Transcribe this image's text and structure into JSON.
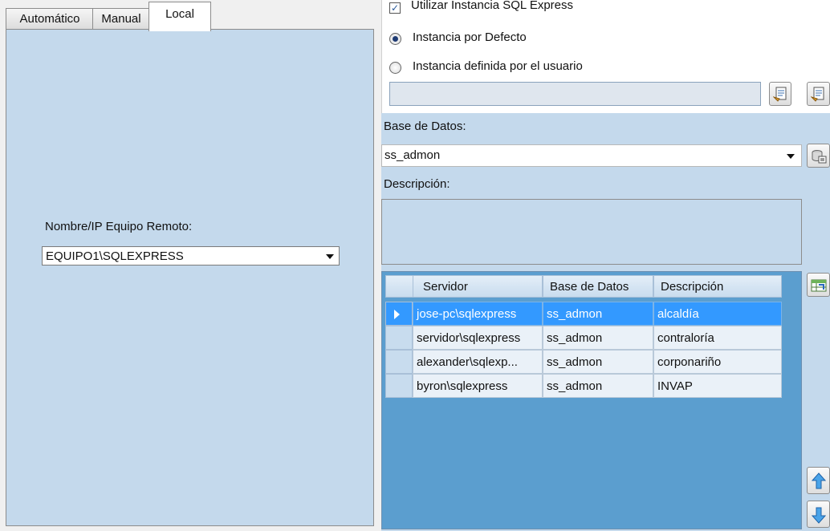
{
  "tabs": [
    {
      "label": "Automático",
      "active": false
    },
    {
      "label": "Manual",
      "active": false
    },
    {
      "label": "Local",
      "active": true
    }
  ],
  "local": {
    "remote_label": "Nombre/IP Equipo Remoto:",
    "remote_value": "EQUIPO1\\SQLEXPRESS"
  },
  "instance": {
    "use_sqlexpress_label": "Utilizar Instancia SQL Express",
    "use_sqlexpress_checked": true,
    "default_label": "Instancia por Defecto",
    "user_defined_label": "Instancia definida por el usuario",
    "selected": "default",
    "custom_value": ""
  },
  "database": {
    "label": "Base de Datos:",
    "value": "ss_admon"
  },
  "description": {
    "label": "Descripción:",
    "value": ""
  },
  "grid": {
    "columns": [
      "Servidor",
      "Base de Datos",
      "Descripción"
    ],
    "rows": [
      {
        "servidor": "jose-pc\\sqlexpress",
        "base": "ss_admon",
        "descripcion": "alcaldía",
        "selected": true
      },
      {
        "servidor": "servidor\\sqlexpress",
        "base": "ss_admon",
        "descripcion": "contraloría",
        "selected": false
      },
      {
        "servidor": "alexander\\sqlexp...",
        "base": "ss_admon",
        "descripcion": "corponariño",
        "selected": false
      },
      {
        "servidor": "byron\\sqlexpress",
        "base": "ss_admon",
        "descripcion": "INVAP",
        "selected": false
      }
    ]
  },
  "icons": {
    "browse_instance": "server-list-icon",
    "browse_instance_alt": "server-list-icon",
    "connect_db": "database-connect-icon",
    "grid_action": "grid-edit-icon",
    "move_up": "arrow-up-icon",
    "move_down": "arrow-down-icon"
  },
  "colors": {
    "panel": "#c4d9ec",
    "grid_bg": "#5b9ecf",
    "selection": "#3399ff"
  }
}
